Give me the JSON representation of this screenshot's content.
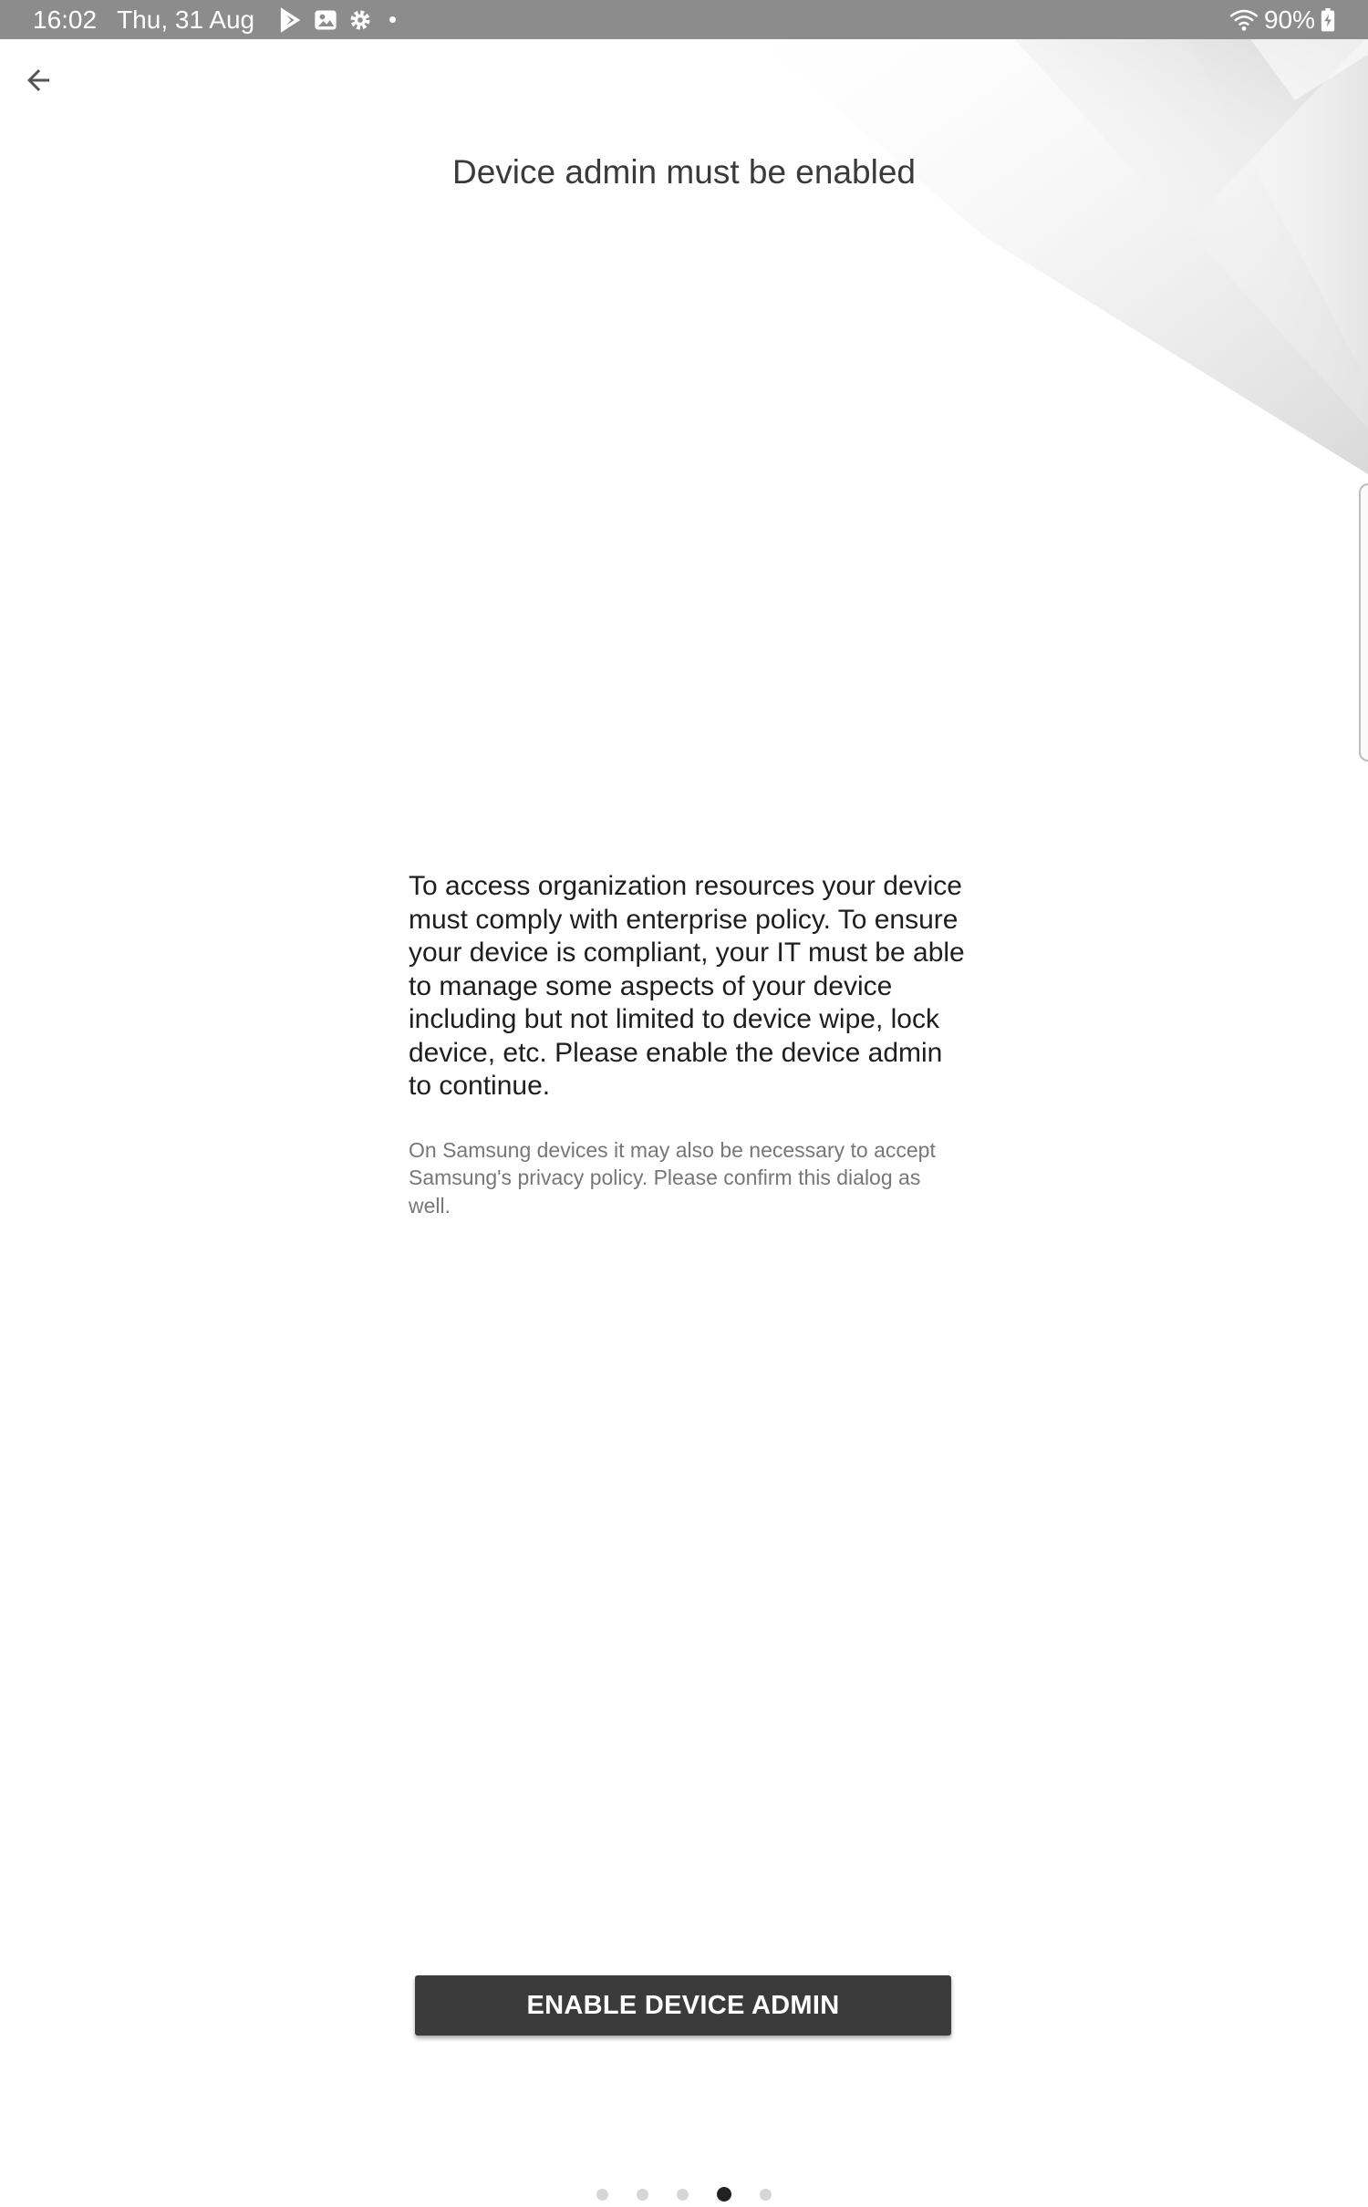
{
  "status_bar": {
    "time": "16:02",
    "date": "Thu, 31 Aug",
    "icons": [
      "play-store-icon",
      "photo-icon",
      "settings-icon"
    ],
    "battery": "90%"
  },
  "header": {
    "title": "Device admin must be enabled"
  },
  "main": {
    "body": "To access organization resources your device must comply with enterprise policy. To ensure your device is compliant, your IT must be able to manage some aspects of your device including but not limited to device wipe, lock device, etc. Please enable the device admin to continue.",
    "note": "On Samsung devices it may also be necessary to accept Samsung's privacy policy. Please confirm this dialog as well."
  },
  "actions": {
    "enable_label": "ENABLE DEVICE ADMIN"
  },
  "pager": {
    "total": 5,
    "current": 4
  },
  "colors": {
    "status_bar": "#8c8c8c",
    "button": "#3b3b3b",
    "active_dot": "#222222",
    "inactive_dot": "#d6d6d6"
  }
}
